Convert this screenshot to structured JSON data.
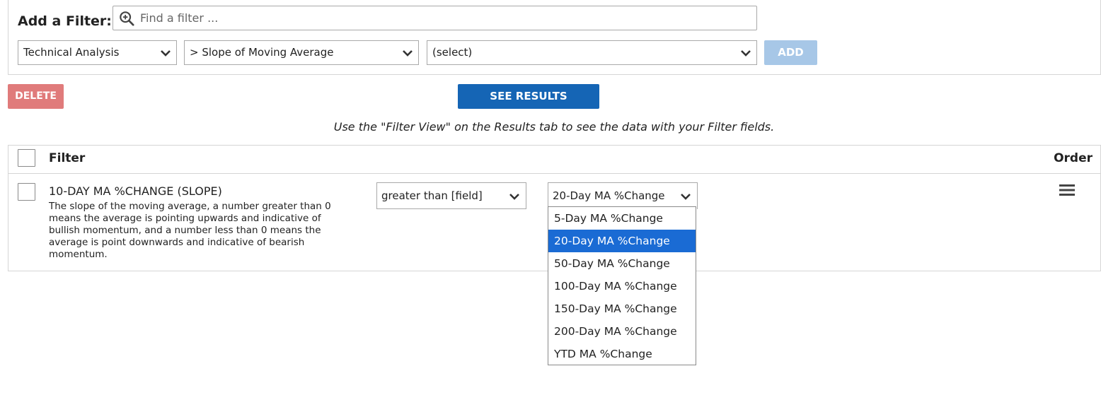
{
  "add_filter": {
    "label": "Add a Filter:",
    "search_placeholder": "Find a filter ...",
    "category_select": "Technical Analysis",
    "filter_select": "> Slope of Moving Average",
    "option_select": "(select)",
    "add_button": "ADD"
  },
  "actions": {
    "delete_button": "DELETE",
    "see_results_button": "SEE RESULTS",
    "hint": "Use the \"Filter View\" on the Results tab to see the data with your Filter fields."
  },
  "table": {
    "header_filter": "Filter",
    "header_order": "Order",
    "row": {
      "title": "10-DAY MA %CHANGE (SLOPE)",
      "description": "The slope of the moving average, a number greater than 0 means the average is pointing upwards and indicative of bullish momentum, and a number less than 0 means the average is point downwards and indicative of bearish momentum.",
      "operator": "greater than [field]",
      "value": "20-Day MA %Change"
    }
  },
  "dropdown": {
    "items": [
      "5-Day MA %Change",
      "20-Day MA %Change",
      "50-Day MA %Change",
      "100-Day MA %Change",
      "150-Day MA %Change",
      "200-Day MA %Change",
      "YTD MA %Change"
    ],
    "selected_index": 1
  },
  "colors": {
    "add_button_bg": "#a7c7e7",
    "delete_button_bg": "#e07b7b",
    "see_results_bg": "#1565b5",
    "dropdown_selected_bg": "#1a6bd4"
  }
}
